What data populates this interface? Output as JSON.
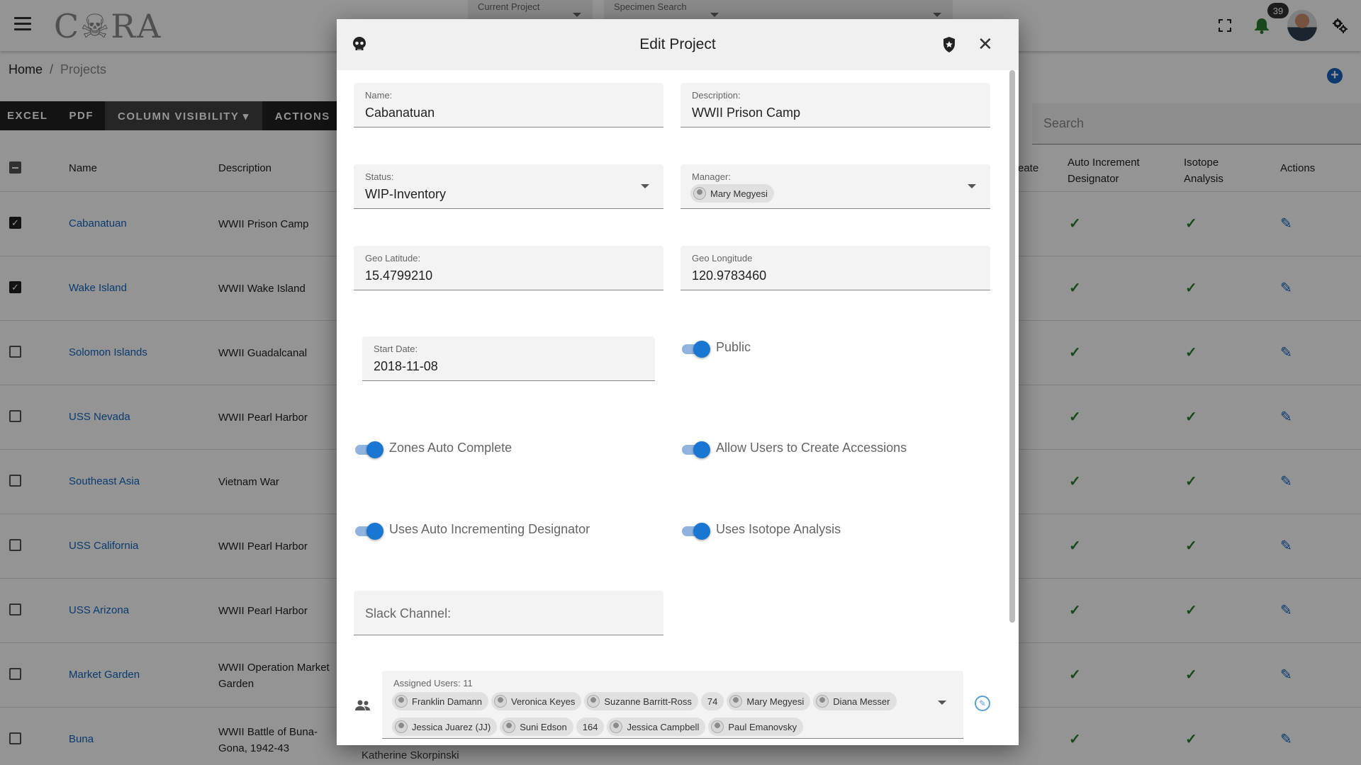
{
  "app": {
    "logo_text": "C☠RA"
  },
  "header": {
    "current_project_label": "Current Project",
    "specimen_search_label": "Specimen Search",
    "notifications_count": "39"
  },
  "breadcrumb": {
    "home": "Home",
    "separator": "/",
    "current": "Projects"
  },
  "toolbar": {
    "excel": "EXCEL",
    "pdf": "PDF",
    "column_visibility": "COLUMN VISIBILITY ▾",
    "actions": "ACTIONS ⋮"
  },
  "search": {
    "placeholder": "Search"
  },
  "table": {
    "headers": {
      "name": "Name",
      "description": "Description",
      "create_partial": "eate",
      "auto_increment_1": "Auto Increment",
      "auto_increment_2": "Designator",
      "isotope_1": "Isotope",
      "isotope_2": "Analysis",
      "actions": "Actions"
    },
    "rows": [
      {
        "checked": true,
        "name": "Cabanatuan",
        "description": "WWII Prison Camp"
      },
      {
        "checked": true,
        "name": "Wake Island",
        "description": "WWII Wake Island"
      },
      {
        "checked": false,
        "name": "Solomon Islands",
        "description": "WWII Guadalcanal"
      },
      {
        "checked": false,
        "name": "USS Nevada",
        "description": "WWII Pearl Harbor"
      },
      {
        "checked": false,
        "name": "Southeast Asia",
        "description": "Vietnam War"
      },
      {
        "checked": false,
        "name": "USS California",
        "description": "WWII Pearl Harbor"
      },
      {
        "checked": false,
        "name": "USS Arizona",
        "description": "WWII Pearl Harbor"
      },
      {
        "checked": false,
        "name": "Market Garden",
        "description": "WWII Operation Market Garden"
      },
      {
        "checked": false,
        "name": "Buna",
        "description": "WWII Battle of Buna-Gona, 1942-43"
      }
    ],
    "check_glyph": "✓",
    "edit_glyph": "✎"
  },
  "dialog": {
    "title": "Edit Project",
    "close_glyph": "✕",
    "name": {
      "label": "Name:",
      "value": "Cabanatuan"
    },
    "description": {
      "label": "Description:",
      "value": "WWII Prison Camp"
    },
    "status": {
      "label": "Status:",
      "value": "WIP-Inventory"
    },
    "manager": {
      "label": "Manager:",
      "value": "Mary Megyesi"
    },
    "geo_latitude": {
      "label": "Geo Latitude:",
      "value": "15.4799210"
    },
    "geo_longitude": {
      "label": "Geo Longitude",
      "value": "120.9783460"
    },
    "start_date": {
      "label": "Start Date:",
      "value": "2018-11-08"
    },
    "toggles": {
      "public": "Public",
      "zones_auto_complete": "Zones Auto Complete",
      "allow_users_create_accessions": "Allow Users to Create Accessions",
      "uses_auto_incrementing_designator": "Uses Auto Incrementing Designator",
      "uses_isotope_analysis": "Uses Isotope Analysis"
    },
    "slack_channel": {
      "label": "Slack Channel:"
    },
    "assigned_users": {
      "label": "Assigned Users: 11",
      "row1": [
        "Franklin Damann",
        "Veronica Keyes",
        "Suzanne Barritt-Ross",
        "74",
        "Mary Megyesi",
        "Diana Messer"
      ],
      "row2": [
        "Jessica Juarez (JJ)",
        "Suni Edson",
        "164",
        "Jessica Campbell",
        "Paul Emanovsky"
      ]
    }
  },
  "below_dialog_text": "Katherine Skorpinski",
  "colors": {
    "link": "#1565c0",
    "check": "#2e7d32",
    "toggle": "#1976d2"
  }
}
